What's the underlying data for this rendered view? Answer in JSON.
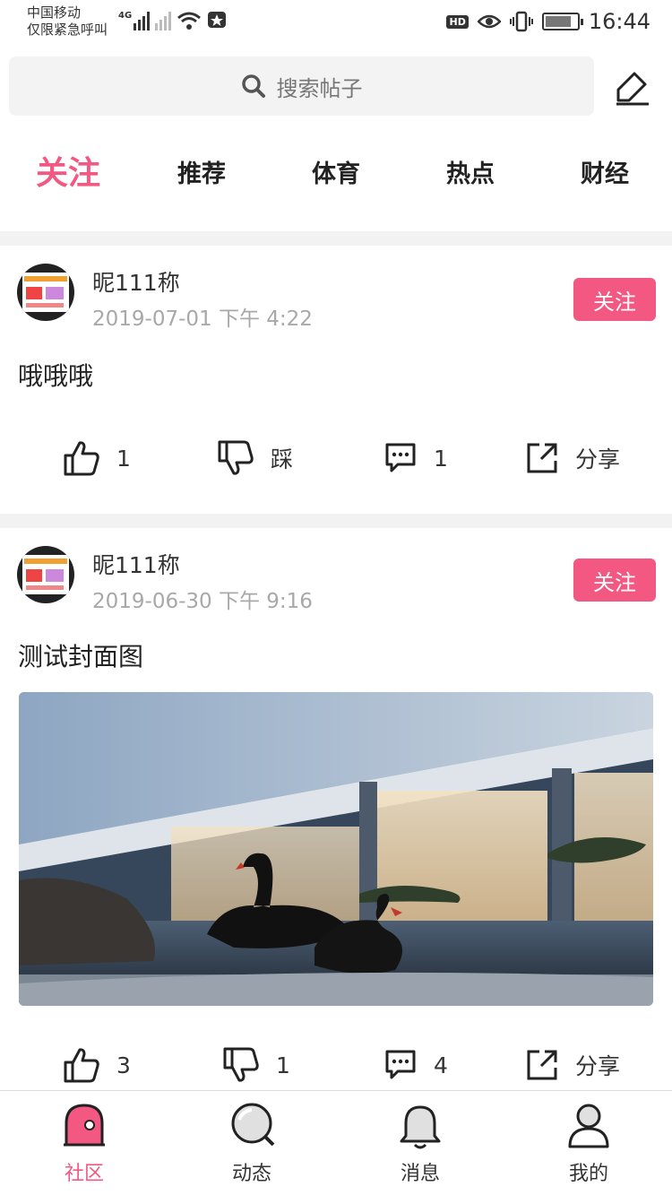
{
  "status_bar": {
    "carrier_line1": "中国移动",
    "carrier_line2": "仅限紧急呼叫",
    "network_label": "4G",
    "hd_label": "HD",
    "time": "16:44"
  },
  "search": {
    "placeholder": "搜索帖子"
  },
  "tabs": [
    {
      "label": "关注",
      "active": true
    },
    {
      "label": "推荐",
      "active": false
    },
    {
      "label": "体育",
      "active": false
    },
    {
      "label": "热点",
      "active": false
    },
    {
      "label": "财经",
      "active": false
    }
  ],
  "posts": [
    {
      "username": "昵111称",
      "timestamp": "2019-07-01 下午 4:22",
      "follow_label": "关注",
      "text": "哦哦哦",
      "has_image": false,
      "likes": "1",
      "dislike": "踩",
      "comments": "1",
      "share": "分享"
    },
    {
      "username": "昵111称",
      "timestamp": "2019-06-30 下午 9:16",
      "follow_label": "关注",
      "text": "测试封面图",
      "has_image": true,
      "likes": "3",
      "dislike": "1",
      "comments": "4",
      "share": "分享"
    }
  ],
  "bottom_nav": [
    {
      "label": "社区",
      "icon": "community-icon",
      "active": true
    },
    {
      "label": "动态",
      "icon": "explore-icon",
      "active": false
    },
    {
      "label": "消息",
      "icon": "bell-icon",
      "active": false
    },
    {
      "label": "我的",
      "icon": "profile-icon",
      "active": false
    }
  ],
  "colors": {
    "accent": "#f25881",
    "divider": "#f2f2f2",
    "muted_text": "#a8a8a8"
  }
}
